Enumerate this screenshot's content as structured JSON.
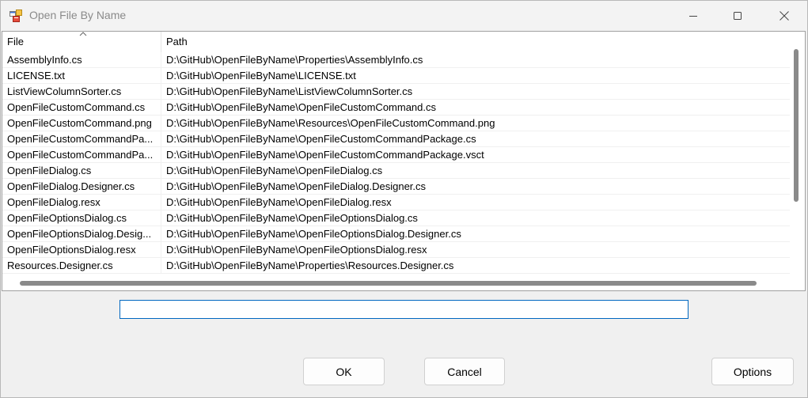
{
  "window": {
    "title": "Open File By Name"
  },
  "list": {
    "columns": {
      "file": "File",
      "path": "Path"
    },
    "rows": [
      {
        "file": "AssemblyInfo.cs",
        "path": "D:\\GitHub\\OpenFileByName\\Properties\\AssemblyInfo.cs"
      },
      {
        "file": "LICENSE.txt",
        "path": "D:\\GitHub\\OpenFileByName\\LICENSE.txt"
      },
      {
        "file": "ListViewColumnSorter.cs",
        "path": "D:\\GitHub\\OpenFileByName\\ListViewColumnSorter.cs"
      },
      {
        "file": "OpenFileCustomCommand.cs",
        "path": "D:\\GitHub\\OpenFileByName\\OpenFileCustomCommand.cs"
      },
      {
        "file": "OpenFileCustomCommand.png",
        "path": "D:\\GitHub\\OpenFileByName\\Resources\\OpenFileCustomCommand.png"
      },
      {
        "file": "OpenFileCustomCommandPa...",
        "path": "D:\\GitHub\\OpenFileByName\\OpenFileCustomCommandPackage.cs"
      },
      {
        "file": "OpenFileCustomCommandPa...",
        "path": "D:\\GitHub\\OpenFileByName\\OpenFileCustomCommandPackage.vsct"
      },
      {
        "file": "OpenFileDialog.cs",
        "path": "D:\\GitHub\\OpenFileByName\\OpenFileDialog.cs"
      },
      {
        "file": "OpenFileDialog.Designer.cs",
        "path": "D:\\GitHub\\OpenFileByName\\OpenFileDialog.Designer.cs"
      },
      {
        "file": "OpenFileDialog.resx",
        "path": "D:\\GitHub\\OpenFileByName\\OpenFileDialog.resx"
      },
      {
        "file": "OpenFileOptionsDialog.cs",
        "path": "D:\\GitHub\\OpenFileByName\\OpenFileOptionsDialog.cs"
      },
      {
        "file": "OpenFileOptionsDialog.Desig...",
        "path": "D:\\GitHub\\OpenFileByName\\OpenFileOptionsDialog.Designer.cs"
      },
      {
        "file": "OpenFileOptionsDialog.resx",
        "path": "D:\\GitHub\\OpenFileByName\\OpenFileOptionsDialog.resx"
      },
      {
        "file": "Resources.Designer.cs",
        "path": "D:\\GitHub\\OpenFileByName\\Properties\\Resources.Designer.cs"
      }
    ]
  },
  "search": {
    "value": ""
  },
  "buttons": {
    "ok": "OK",
    "cancel": "Cancel",
    "options": "Options"
  },
  "icons": {
    "app": "app-icon",
    "minimize": "minimize-icon",
    "maximize": "maximize-icon",
    "close": "close-icon",
    "sort": "sort-ascending-icon"
  },
  "colors": {
    "focus_border": "#0067c0",
    "scroll_thumb": "#8a8a8a"
  }
}
